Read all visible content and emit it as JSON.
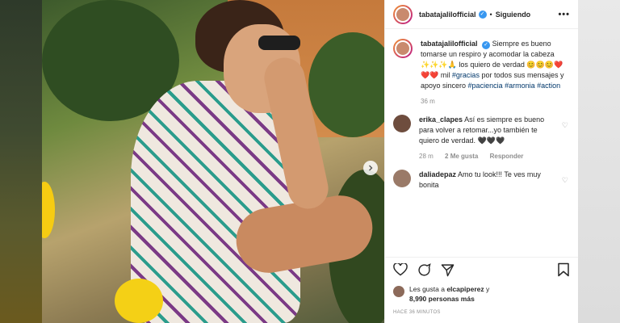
{
  "header": {
    "username": "tabatajalilofficial",
    "separator": "•",
    "follow_label": "Siguiendo",
    "more_label": "•••"
  },
  "caption": {
    "username": "tabatajalilofficial",
    "text_1": "Siempre es bueno tomarse un respiro y acomodar la cabeza ",
    "emoji_1": "✨✨✨🙏",
    "text_2": " los quiero de verdad ",
    "emoji_2": "😊😊😊❤️❤️❤️",
    "text_3": " mil ",
    "tag_1": "#gracias",
    "text_4": " por todos sus mensajes y apoyo sincero ",
    "tag_2": "#paciencia",
    "tag_3": "#armonia",
    "tag_4": "#action",
    "time": "36 m"
  },
  "comments": [
    {
      "username": "erika_clapes",
      "text": "Así es siempre es bueno para volver a retomar...yo también te quiero de verdad. 🖤🖤🖤",
      "time": "28 m",
      "likes": "2 Me gusta",
      "reply": "Responder"
    },
    {
      "username": "daliadepaz",
      "text": "Amo tu look!!! Te ves muy bonita"
    }
  ],
  "likes": {
    "prefix": "Les gusta a ",
    "user": "elcapiperez",
    "middle": " y",
    "count": "8,990 personas más"
  },
  "posted_ago": "HACE 36 MINUTOS",
  "icons": {
    "like": "heart-icon",
    "comment": "comment-icon",
    "share": "paper-plane-icon",
    "save": "bookmark-icon",
    "next": "chevron-right-icon"
  },
  "colors": {
    "link": "#00376b",
    "verified": "#3897f0",
    "muted": "#8e8e8e"
  }
}
